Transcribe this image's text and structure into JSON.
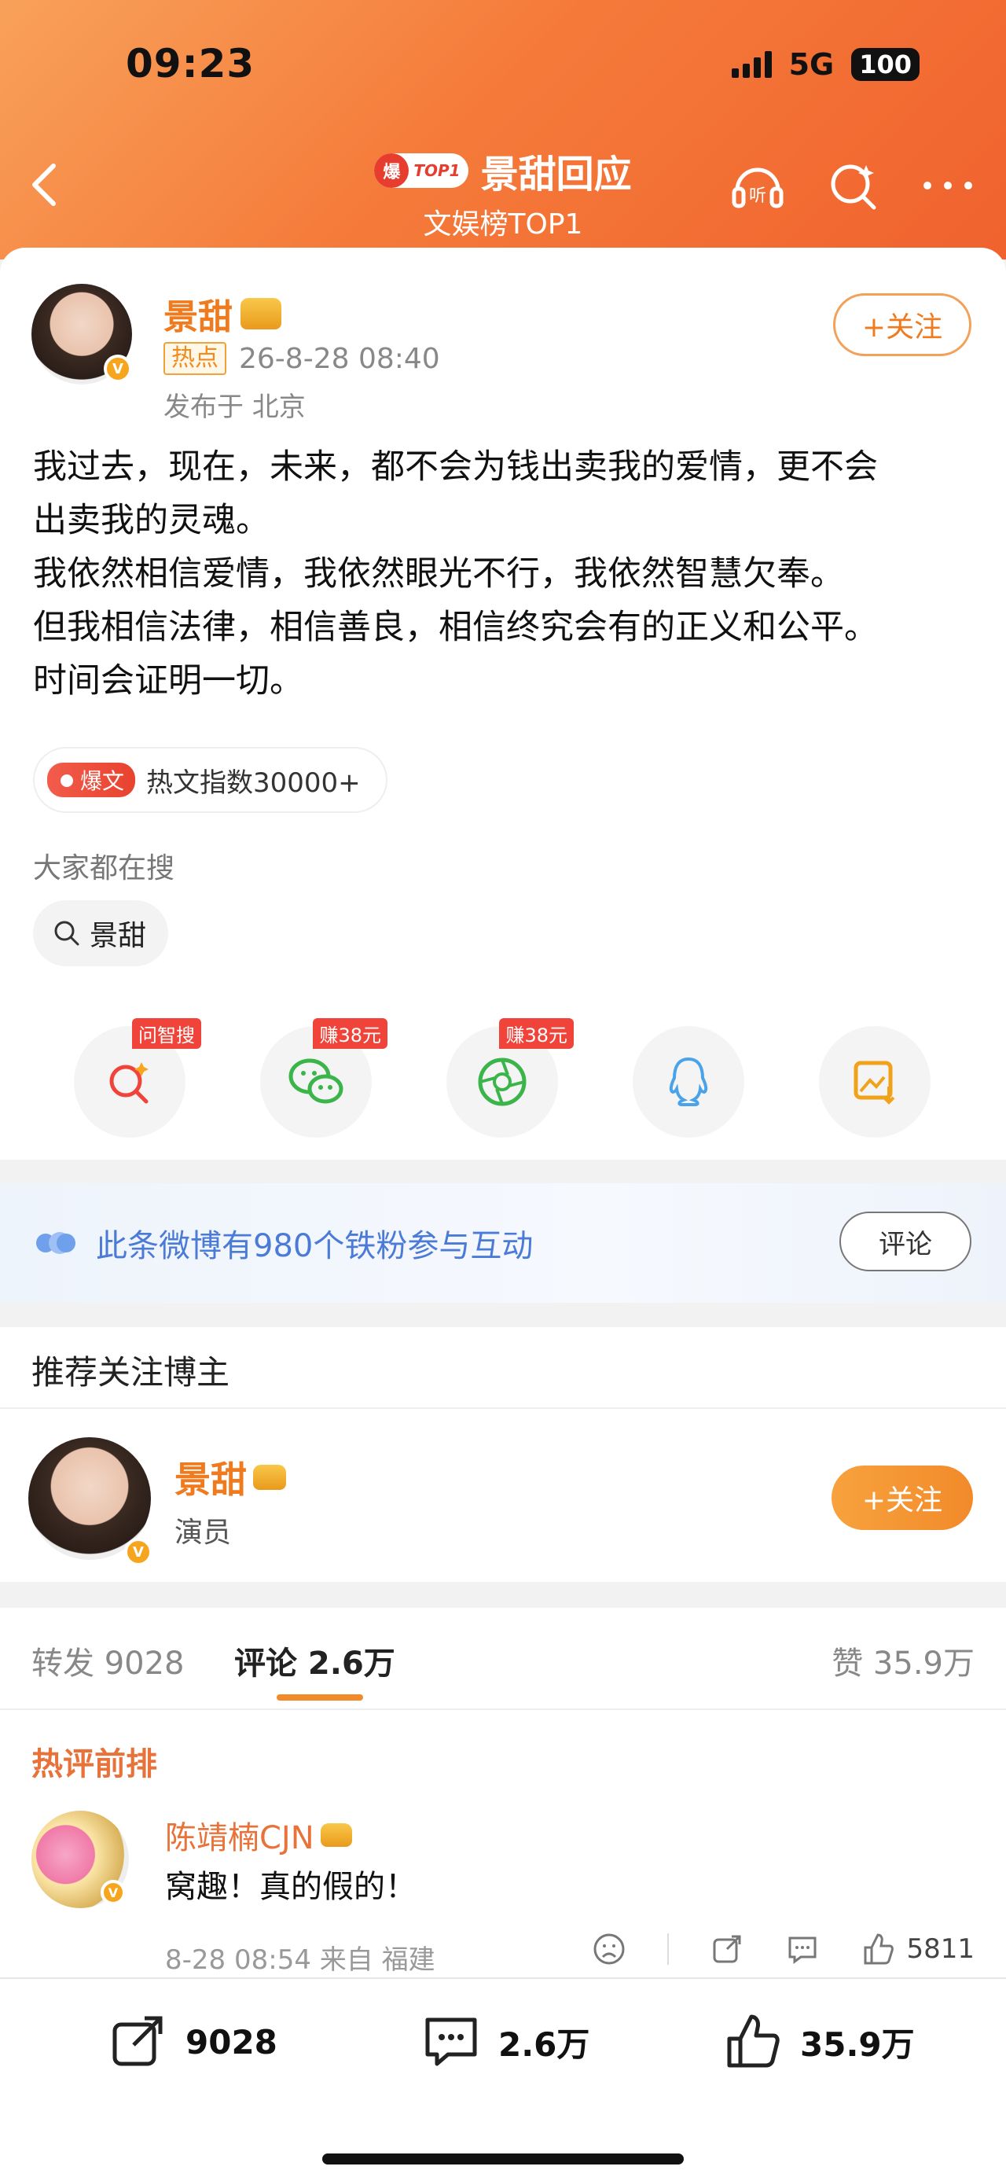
{
  "status_bar": {
    "time": "09:23",
    "network": "5G",
    "battery": "100"
  },
  "header": {
    "badge_fire": "爆",
    "badge_top": "TOP1",
    "title": "景甜回应",
    "subtitle": "文娱榜TOP1"
  },
  "post": {
    "author": "景甜",
    "tag": "热点",
    "time": "26-8-28 08:40",
    "location": "发布于 北京",
    "follow_label": "+关注",
    "lines": [
      "我过去，现在，未来，都不会为钱出卖我的爱情，更不会",
      "出卖我的灵魂。",
      "我依然相信爱情，我依然眼光不行，我依然智慧欠奉。",
      "但我相信法律，相信善良，相信终究会有的正义和公平。",
      "时间会证明一切。"
    ],
    "hot_badge": "爆文",
    "hot_index": "热文指数30000+",
    "search_label": "大家都在搜",
    "search_chip": "景甜"
  },
  "share": {
    "items": [
      {
        "icon": "ai-search-icon",
        "tag": "问智搜"
      },
      {
        "icon": "wechat-icon",
        "tag": "赚38元"
      },
      {
        "icon": "moments-icon",
        "tag": "赚38元"
      },
      {
        "icon": "qq-icon",
        "tag": ""
      },
      {
        "icon": "save-image-icon",
        "tag": ""
      }
    ]
  },
  "fans_banner": {
    "text": "此条微博有980个铁粉参与互动",
    "button": "评论"
  },
  "recommend": {
    "heading": "推荐关注博主",
    "name": "景甜",
    "role": "演员",
    "follow_label": "+关注"
  },
  "tabs": {
    "repost": "转发 9028",
    "comment": "评论 2.6万",
    "like": "赞 35.9万"
  },
  "comments": {
    "heading": "热评前排",
    "items": [
      {
        "user": "陈靖楠CJN",
        "text": "窝趣！真的假的！",
        "meta": "8-28 08:54 来自 福建",
        "likes": "5811"
      }
    ]
  },
  "bottom_bar": {
    "repost": "9028",
    "comment": "2.6万",
    "like": "35.9万"
  },
  "colors": {
    "accent": "#f07b1e",
    "header_start": "#f8a15a",
    "header_end": "#f0622e",
    "link_blue": "#4b7bd6"
  }
}
